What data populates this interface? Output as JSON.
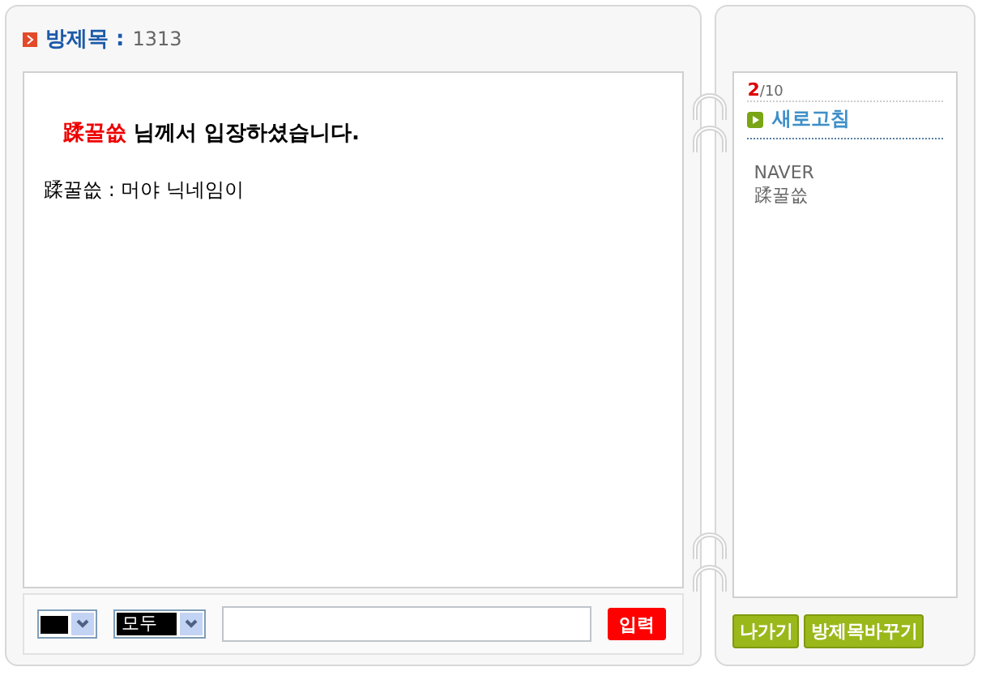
{
  "room": {
    "label": "방제목 :",
    "title": "1313"
  },
  "messages": [
    {
      "kind": "system",
      "user": "蹂꿀씂",
      "text": "님께서 입장하셨습니다."
    },
    {
      "kind": "chat",
      "text": "蹂꿀씂 : 머야 닉네임이"
    }
  ],
  "sidebar": {
    "count": "2",
    "capacity": "/10",
    "refresh": "새로고침",
    "users": [
      "NAVER",
      "蹂꿀씂"
    ]
  },
  "input_bar": {
    "color": "#000000",
    "target": "모두",
    "send": "입력"
  },
  "buttons": [
    "나가기",
    "방제목바꾸기"
  ]
}
